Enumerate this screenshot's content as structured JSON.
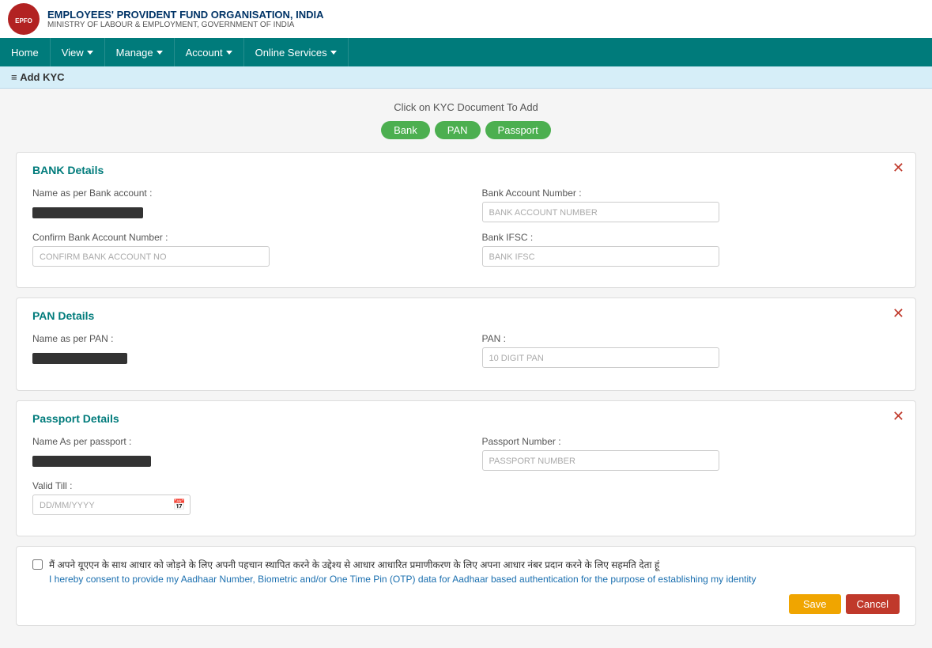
{
  "header": {
    "org_name": "EMPLOYEES' PROVIDENT FUND ORGANISATION, INDIA",
    "ministry": "MINISTRY OF LABOUR & EMPLOYMENT, GOVERNMENT OF INDIA",
    "logo_text": "EPFO"
  },
  "navbar": {
    "items": [
      {
        "label": "Home",
        "has_dropdown": false
      },
      {
        "label": "View",
        "has_dropdown": true
      },
      {
        "label": "Manage",
        "has_dropdown": true
      },
      {
        "label": "Account",
        "has_dropdown": true
      },
      {
        "label": "Online Services",
        "has_dropdown": true
      }
    ]
  },
  "breadcrumb": {
    "icon": "≡",
    "title": "Add KYC"
  },
  "kyc_instruction": "Click on KYC Document To Add",
  "kyc_buttons": [
    "Bank",
    "PAN",
    "Passport"
  ],
  "bank_section": {
    "title": "BANK Details",
    "fields": {
      "name_label": "Name as per Bank account  :",
      "account_number_label": "Bank Account Number  :",
      "account_number_placeholder": "BANK ACCOUNT NUMBER",
      "confirm_label": "Confirm Bank Account Number  :",
      "confirm_placeholder": "CONFIRM BANK ACCOUNT NO",
      "ifsc_label": "Bank IFSC  :",
      "ifsc_placeholder": "BANK IFSC"
    }
  },
  "pan_section": {
    "title": "PAN Details",
    "fields": {
      "name_label": "Name as per PAN  :",
      "pan_label": "PAN  :",
      "pan_placeholder": "10 DIGIT PAN"
    }
  },
  "passport_section": {
    "title": "Passport Details",
    "fields": {
      "name_label": "Name As per passport  :",
      "number_label": "Passport Number  :",
      "number_placeholder": "PASSPORT NUMBER",
      "valid_till_label": "Valid Till  :",
      "valid_till_placeholder": "DD/MM/YYYY"
    }
  },
  "consent": {
    "text_hi": "मैं अपने यूएएन के साथ आधार को जोड़ने के लिए अपनी पहचान स्थापित करने के उद्देश्य से आधार आधारित प्रमाणीकरण के लिए अपना आधार नंबर प्रदान करने के लिए सहमति देता हूं",
    "text_en": "I hereby consent to provide my Aadhaar Number, Biometric and/or One Time Pin (OTP) data for Aadhaar based authentication for the purpose of establishing my identity"
  },
  "actions": {
    "save_label": "Save",
    "cancel_label": "Cancel"
  },
  "colors": {
    "teal": "#007b7b",
    "green": "#4caf50",
    "red": "#c0392b",
    "orange": "#f0a500"
  }
}
